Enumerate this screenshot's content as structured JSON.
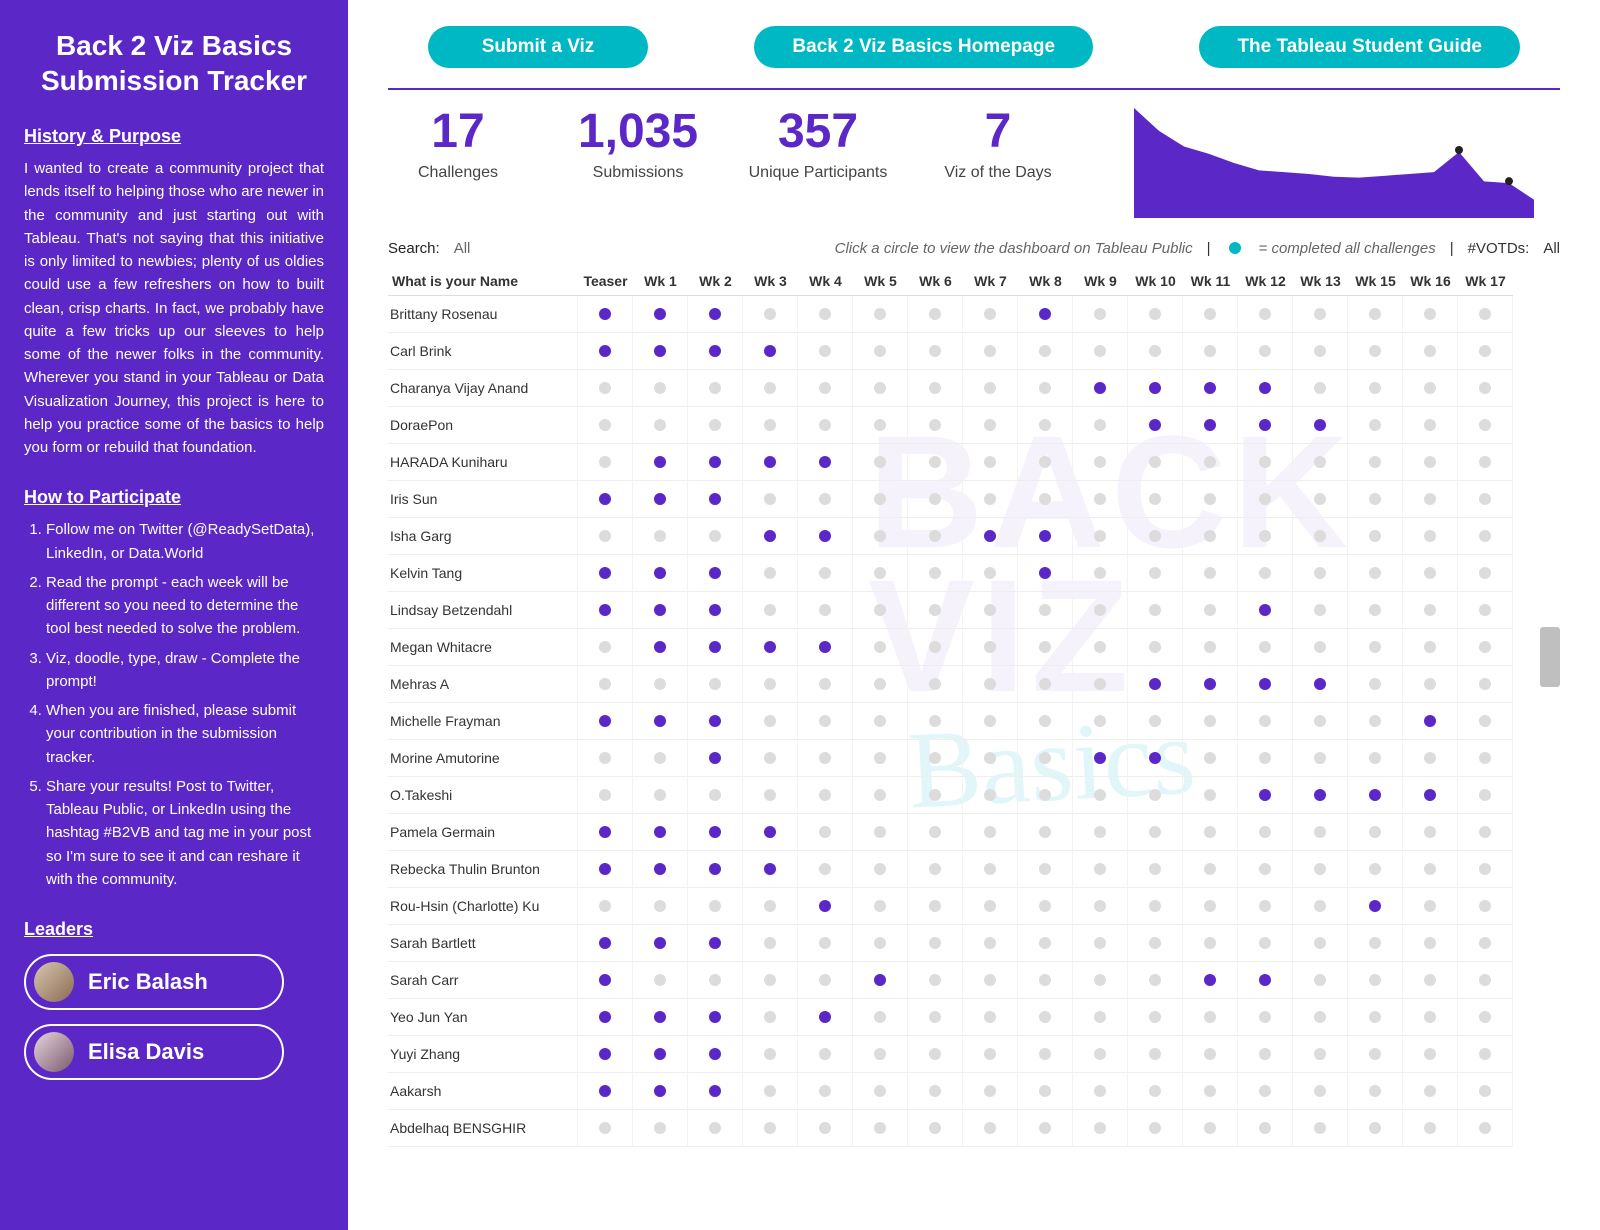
{
  "sidebar": {
    "title": "Back 2 Viz Basics Submission Tracker",
    "history_heading": "History & Purpose",
    "history_body": "I wanted to create a community project that lends itself to helping those who are newer in the community and just starting out with Tableau. That's not saying that this initiative is only limited to newbies; plenty of us oldies could use a few refreshers on how to built clean, crisp charts. In fact, we probably have quite a few tricks up our sleeves to help some of the newer folks in the community. Wherever you stand in your Tableau or Data Visualization Journey, this project is here to help you practice some of the basics to help you form or rebuild that foundation.",
    "participate_heading": "How to Participate",
    "participate_items": [
      "Follow me on Twitter (@ReadySetData), LinkedIn, or Data.World",
      "Read the prompt - each week will be different so you need to determine the tool best needed to solve the problem.",
      "Viz, doodle, type, draw - Complete the prompt!",
      "When you are finished, please submit your contribution in the submission tracker.",
      "Share your results! Post to Twitter, Tableau Public, or LinkedIn using the hashtag #B2VB and tag me in your post so I'm sure to see it and can reshare it with the community."
    ],
    "leaders_heading": "Leaders",
    "leaders": [
      {
        "name": "Eric Balash"
      },
      {
        "name": "Elisa Davis"
      }
    ]
  },
  "topbuttons": [
    "Submit a Viz",
    "Back 2 Viz Basics Homepage",
    "The Tableau Student Guide"
  ],
  "stats": [
    {
      "value": "17",
      "label": "Challenges"
    },
    {
      "value": "1,035",
      "label": "Submissions"
    },
    {
      "value": "357",
      "label": "Unique Participants"
    },
    {
      "value": "7",
      "label": "Viz of the Days"
    }
  ],
  "meta": {
    "search_label": "Search:",
    "search_value": "All",
    "hint": "Click a circle to view the dashboard on Tableau Public",
    "legend_text": "= completed all challenges",
    "votd_label": "#VOTDs:",
    "votd_value": "All"
  },
  "columns": [
    "What is your Name",
    "Teaser",
    "Wk 1",
    "Wk 2",
    "Wk 3",
    "Wk 4",
    "Wk 5",
    "Wk 6",
    "Wk 7",
    "Wk 8",
    "Wk 9",
    "Wk 10",
    "Wk 11",
    "Wk 12",
    "Wk 13",
    "Wk 15",
    "Wk 16",
    "Wk 17"
  ],
  "rows": [
    {
      "name": "Brittany Rosenau",
      "marks": [
        1,
        1,
        1,
        0,
        0,
        0,
        0,
        0,
        1,
        0,
        0,
        0,
        0,
        0,
        0,
        0,
        0
      ]
    },
    {
      "name": "Carl Brink",
      "marks": [
        1,
        1,
        1,
        1,
        0,
        0,
        0,
        0,
        0,
        0,
        0,
        0,
        0,
        0,
        0,
        0,
        0
      ]
    },
    {
      "name": "Charanya Vijay Anand",
      "marks": [
        0,
        0,
        0,
        0,
        0,
        0,
        0,
        0,
        0,
        1,
        1,
        1,
        1,
        0,
        0,
        0,
        0
      ]
    },
    {
      "name": "DoraePon",
      "marks": [
        0,
        0,
        0,
        0,
        0,
        0,
        0,
        0,
        0,
        0,
        1,
        1,
        1,
        1,
        0,
        0,
        0
      ]
    },
    {
      "name": "HARADA Kuniharu",
      "marks": [
        0,
        1,
        1,
        1,
        1,
        0,
        0,
        0,
        0,
        0,
        0,
        0,
        0,
        0,
        0,
        0,
        0
      ]
    },
    {
      "name": "Iris Sun",
      "marks": [
        1,
        1,
        1,
        0,
        0,
        0,
        0,
        0,
        0,
        0,
        0,
        0,
        0,
        0,
        0,
        0,
        0
      ]
    },
    {
      "name": "Isha Garg",
      "marks": [
        0,
        0,
        0,
        1,
        1,
        0,
        0,
        1,
        1,
        0,
        0,
        0,
        0,
        0,
        0,
        0,
        0
      ]
    },
    {
      "name": "Kelvin Tang",
      "marks": [
        1,
        1,
        1,
        0,
        0,
        0,
        0,
        0,
        1,
        0,
        0,
        0,
        0,
        0,
        0,
        0,
        0
      ]
    },
    {
      "name": "Lindsay Betzendahl",
      "marks": [
        1,
        1,
        1,
        0,
        0,
        0,
        0,
        0,
        0,
        0,
        0,
        0,
        1,
        0,
        0,
        0,
        0
      ]
    },
    {
      "name": "Megan Whitacre",
      "marks": [
        0,
        1,
        1,
        1,
        1,
        0,
        0,
        0,
        0,
        0,
        0,
        0,
        0,
        0,
        0,
        0,
        0
      ]
    },
    {
      "name": "Mehras A",
      "marks": [
        0,
        0,
        0,
        0,
        0,
        0,
        0,
        0,
        0,
        0,
        1,
        1,
        1,
        1,
        0,
        0,
        0
      ]
    },
    {
      "name": "Michelle Frayman",
      "marks": [
        1,
        1,
        1,
        0,
        0,
        0,
        0,
        0,
        0,
        0,
        0,
        0,
        0,
        0,
        0,
        1,
        0
      ]
    },
    {
      "name": "Morine Amutorine",
      "marks": [
        0,
        0,
        1,
        0,
        0,
        0,
        0,
        0,
        0,
        1,
        1,
        0,
        0,
        0,
        0,
        0,
        0
      ]
    },
    {
      "name": "O.Takeshi",
      "marks": [
        0,
        0,
        0,
        0,
        0,
        0,
        0,
        0,
        0,
        0,
        0,
        0,
        1,
        1,
        1,
        1,
        0
      ]
    },
    {
      "name": "Pamela Germain",
      "marks": [
        1,
        1,
        1,
        1,
        0,
        0,
        0,
        0,
        0,
        0,
        0,
        0,
        0,
        0,
        0,
        0,
        0
      ]
    },
    {
      "name": "Rebecka Thulin Brunton",
      "marks": [
        1,
        1,
        1,
        1,
        0,
        0,
        0,
        0,
        0,
        0,
        0,
        0,
        0,
        0,
        0,
        0,
        0
      ]
    },
    {
      "name": "Rou-Hsin (Charlotte) Ku",
      "marks": [
        0,
        0,
        0,
        0,
        1,
        0,
        0,
        0,
        0,
        0,
        0,
        0,
        0,
        0,
        1,
        0,
        0
      ]
    },
    {
      "name": "Sarah Bartlett",
      "marks": [
        1,
        1,
        1,
        0,
        0,
        0,
        0,
        0,
        0,
        0,
        0,
        0,
        0,
        0,
        0,
        0,
        0
      ]
    },
    {
      "name": "Sarah Carr",
      "marks": [
        1,
        0,
        0,
        0,
        0,
        1,
        0,
        0,
        0,
        0,
        0,
        1,
        1,
        0,
        0,
        0,
        0
      ]
    },
    {
      "name": "Yeo Jun Yan",
      "marks": [
        1,
        1,
        1,
        0,
        1,
        0,
        0,
        0,
        0,
        0,
        0,
        0,
        0,
        0,
        0,
        0,
        0
      ]
    },
    {
      "name": "Yuyi Zhang",
      "marks": [
        1,
        1,
        1,
        0,
        0,
        0,
        0,
        0,
        0,
        0,
        0,
        0,
        0,
        0,
        0,
        0,
        0
      ]
    },
    {
      "name": "Aakarsh",
      "marks": [
        1,
        1,
        1,
        0,
        0,
        0,
        0,
        0,
        0,
        0,
        0,
        0,
        0,
        0,
        0,
        0,
        0
      ]
    },
    {
      "name": "Abdelhaq BENSGHIR",
      "marks": [
        0,
        0,
        0,
        0,
        0,
        0,
        0,
        0,
        0,
        0,
        0,
        0,
        0,
        0,
        0,
        0,
        0
      ]
    }
  ],
  "chart_data": {
    "type": "area",
    "x": [
      "Teaser",
      "Wk 1",
      "Wk 2",
      "Wk 3",
      "Wk 4",
      "Wk 5",
      "Wk 6",
      "Wk 7",
      "Wk 8",
      "Wk 9",
      "Wk 10",
      "Wk 11",
      "Wk 12",
      "Wk 13",
      "Wk 15",
      "Wk 16",
      "Wk 17"
    ],
    "values": [
      120,
      95,
      78,
      70,
      60,
      52,
      50,
      48,
      45,
      44,
      46,
      48,
      50,
      72,
      40,
      38,
      20
    ],
    "ylim": [
      0,
      120
    ],
    "title": "",
    "xlabel": "",
    "ylabel": ""
  }
}
